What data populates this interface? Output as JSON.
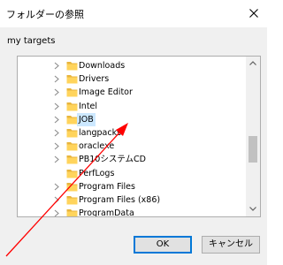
{
  "window": {
    "title": "フォルダーの参照"
  },
  "instruction": "my targets",
  "tree": {
    "items": [
      {
        "label": "Downloads",
        "expandable": true,
        "selected": false
      },
      {
        "label": "Drivers",
        "expandable": true,
        "selected": false
      },
      {
        "label": "Image Editor",
        "expandable": true,
        "selected": false
      },
      {
        "label": "Intel",
        "expandable": true,
        "selected": false
      },
      {
        "label": "JOB",
        "expandable": true,
        "selected": true
      },
      {
        "label": "langpacks",
        "expandable": true,
        "selected": false
      },
      {
        "label": "oraclexe",
        "expandable": true,
        "selected": false
      },
      {
        "label": "PB10システムCD",
        "expandable": true,
        "selected": false
      },
      {
        "label": "PerfLogs",
        "expandable": false,
        "selected": false
      },
      {
        "label": "Program Files",
        "expandable": true,
        "selected": false
      },
      {
        "label": "Program Files (x86)",
        "expandable": true,
        "selected": false
      },
      {
        "label": "ProgramData",
        "expandable": true,
        "selected": false
      }
    ]
  },
  "buttons": {
    "ok": "OK",
    "cancel": "キャンセル"
  },
  "colors": {
    "selection": "#cce8ff",
    "folder": "#ffd45c",
    "arrow": "#ff0000",
    "default_button_border": "#0078d7"
  }
}
